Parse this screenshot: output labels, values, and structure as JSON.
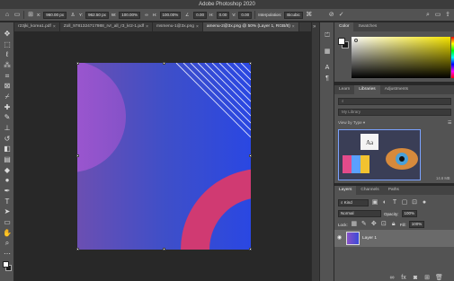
{
  "window": {
    "title": "Adobe Photoshop 2020"
  },
  "options_bar": {
    "x_label": "X:",
    "x_value": "960.00 px",
    "y_label": "Y:",
    "y_value": "962.50 px",
    "w_label": "W:",
    "w_value": "100.00%",
    "h_label": "H:",
    "h_value": "100.00%",
    "angle_value": "0.00",
    "h_skew_label": "H:",
    "h_skew_value": "0.00",
    "v_skew_label": "V:",
    "v_skew_value": "0.00",
    "interp_label": "Interpolation:",
    "interp_value": "Bicubic"
  },
  "document_tabs": [
    {
      "label": "r23jki_korea1.pdf",
      "active": false
    },
    {
      "label": "Zoll_9781324717988_rvr_all_r3_kr2-1.pdf",
      "active": false
    },
    {
      "label": "msmenu-1@3x.png",
      "active": false
    },
    {
      "label": "amenu-2@3x.png @ 50% (Layer 1, RGB/8)",
      "active": true
    }
  ],
  "color_panel": {
    "tabs": [
      "Color",
      "Swatches"
    ],
    "active": "Color"
  },
  "library_panel": {
    "tabs": [
      "Learn",
      "Libraries",
      "Adjustments"
    ],
    "active": "Libraries",
    "search_placeholder": "",
    "library_name": "My Library",
    "view_by": "View by Type",
    "size_label": "14.6 MB"
  },
  "layers_panel": {
    "tabs": [
      "Layers",
      "Channels",
      "Paths"
    ],
    "active": "Layers",
    "kind_label": "Kind",
    "blend_mode": "Normal",
    "opacity_label": "Opacity:",
    "opacity_value": "100%",
    "lock_label": "Lock:",
    "fill_label": "Fill:",
    "fill_value": "100%",
    "layers": [
      {
        "name": "Layer 1",
        "visible": true
      }
    ]
  },
  "colors": {
    "ui_dark": "#282828",
    "ui_panel": "#535353",
    "selection_row": "#6a6a6a",
    "shape_magenta": "#d03a72",
    "shape_purple": "#a35ad0"
  }
}
